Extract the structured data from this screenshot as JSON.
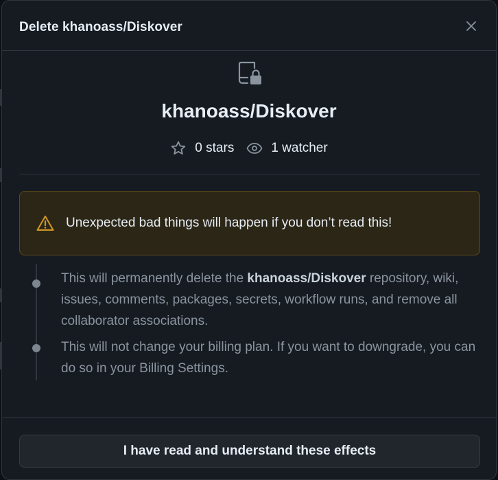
{
  "dialog": {
    "title": "Delete khanoass/Diskover",
    "close_icon": "x-icon"
  },
  "repo": {
    "icon": "repo-locked-icon",
    "name": "khanoass/Diskover",
    "stars": "0 stars",
    "watchers": "1 watcher",
    "star_icon": "star-icon",
    "watch_icon": "eye-icon"
  },
  "warning": {
    "icon": "alert-icon",
    "text": "Unexpected bad things will happen if you don’t read this!",
    "color": "#d29922"
  },
  "effects": [
    {
      "before": "This will permanently delete the ",
      "bold": "khanoass/Diskover",
      "after": " repository, wiki, issues, comments, packages, secrets, workflow runs, and remove all collaborator associations."
    },
    {
      "before": "This will not change your billing plan. If you want to downgrade, you can do so in your Billing Settings.",
      "bold": "",
      "after": ""
    }
  ],
  "confirm_button": {
    "label": "I have read and understand these effects"
  }
}
